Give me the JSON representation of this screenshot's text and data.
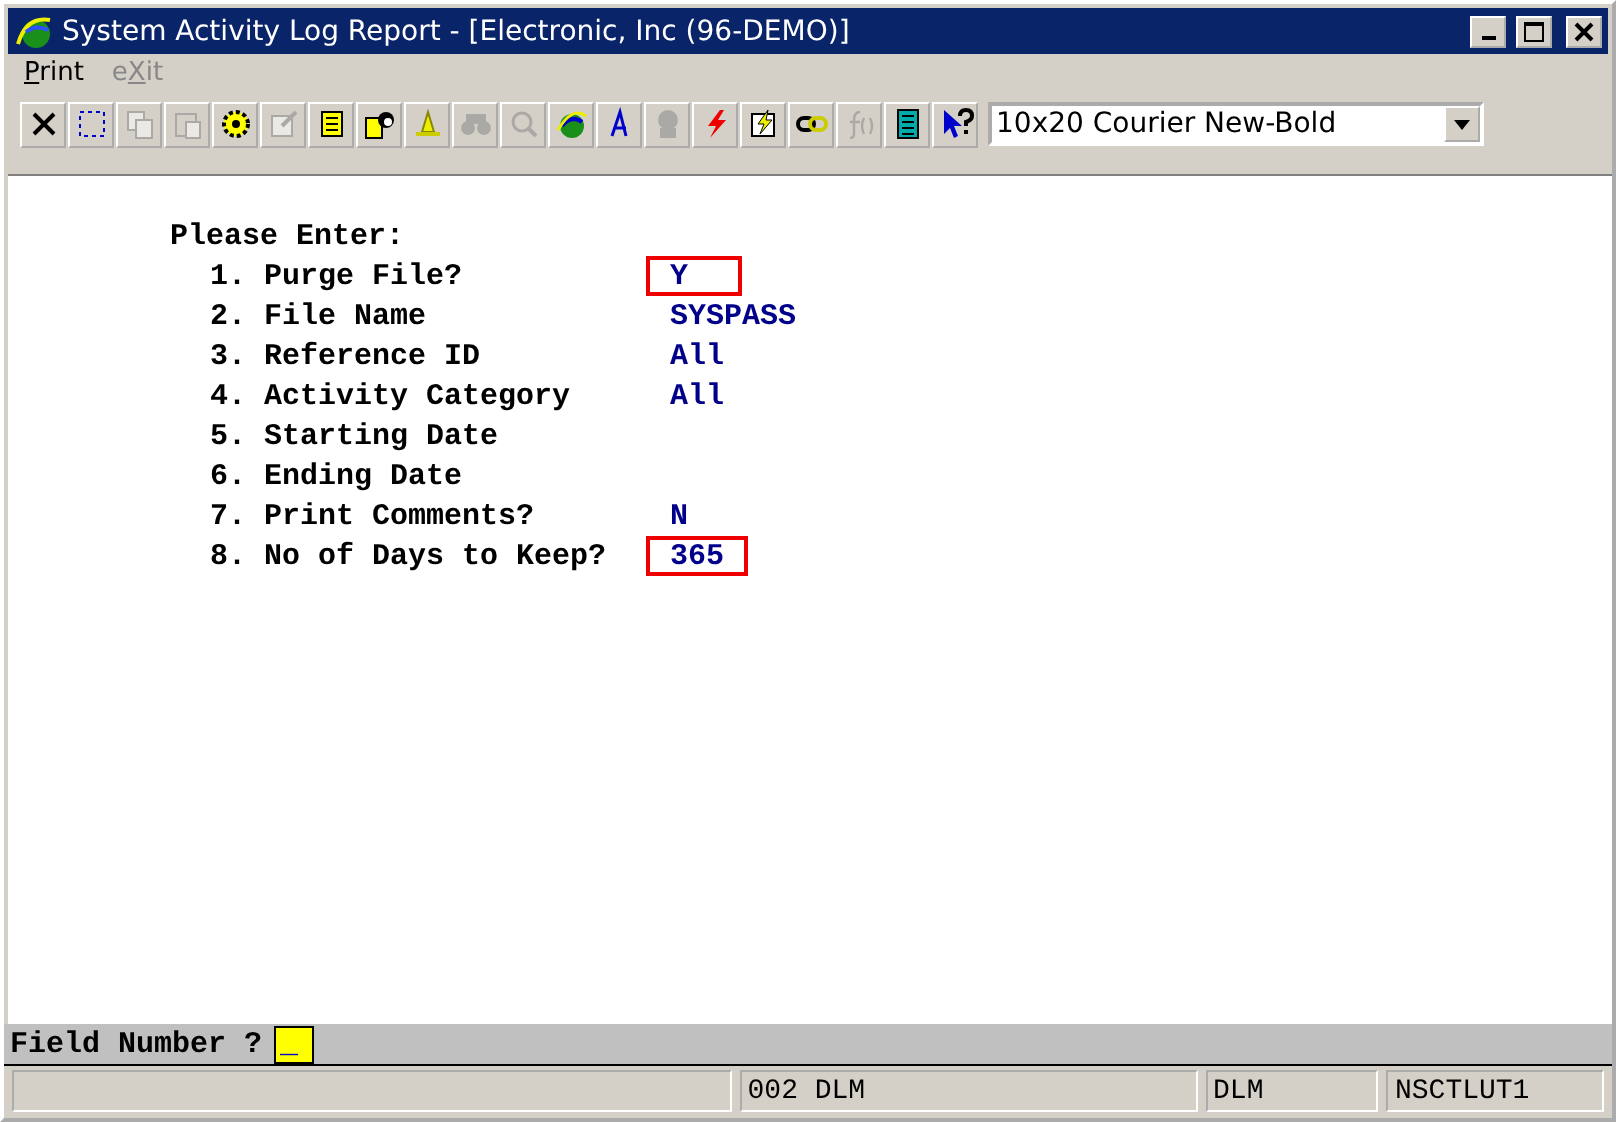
{
  "window": {
    "title": "System Activity Log Report - [Electronic, Inc (96-DEMO)]"
  },
  "menu": [
    {
      "key": "P",
      "after": "rint",
      "disabled": false
    },
    {
      "before": "e",
      "key": "X",
      "after": "it",
      "disabled": true
    }
  ],
  "toolbar": [
    {
      "kind": "close",
      "disabled": false
    },
    {
      "kind": "select",
      "disabled": false
    },
    {
      "kind": "copy",
      "disabled": true
    },
    {
      "kind": "paste",
      "disabled": true
    },
    {
      "kind": "gear",
      "disabled": false
    },
    {
      "kind": "properties",
      "disabled": true
    },
    {
      "kind": "note",
      "disabled": false
    },
    {
      "kind": "person",
      "disabled": false
    },
    {
      "kind": "bell",
      "disabled": false
    },
    {
      "kind": "binoculars",
      "disabled": true
    },
    {
      "kind": "magnifier",
      "disabled": true
    },
    {
      "kind": "globe",
      "disabled": false
    },
    {
      "kind": "font",
      "disabled": false
    },
    {
      "kind": "head",
      "disabled": true
    },
    {
      "kind": "bolt",
      "disabled": false
    },
    {
      "kind": "boltdoc",
      "disabled": false
    },
    {
      "kind": "link",
      "disabled": false
    },
    {
      "kind": "function",
      "disabled": true
    },
    {
      "kind": "calculator",
      "disabled": false
    },
    {
      "kind": "help",
      "disabled": false
    }
  ],
  "font_select": {
    "value": "10x20 Courier New-Bold"
  },
  "form": {
    "heading": "Please Enter:",
    "fields": [
      {
        "number": "1.",
        "label": "Purge File?",
        "value": "Y",
        "highlighted": true
      },
      {
        "number": "2.",
        "label": "File Name",
        "value": "SYSPASS",
        "highlighted": false
      },
      {
        "number": "3.",
        "label": "Reference ID",
        "value": "All",
        "highlighted": false
      },
      {
        "number": "4.",
        "label": "Activity Category",
        "value": "All",
        "highlighted": false
      },
      {
        "number": "5.",
        "label": "Starting Date",
        "highlighted": false
      },
      {
        "number": "6.",
        "label": "Ending Date",
        "highlighted": false
      },
      {
        "number": "7.",
        "label": "Print Comments?",
        "value": "N",
        "highlighted": false
      },
      {
        "number": "8.",
        "label": "No of Days to Keep?",
        "value": "365",
        "highlighted": true
      }
    ]
  },
  "prompt": {
    "label": "Field Number ?",
    "value": "_"
  },
  "status_bar": [
    "002 DLM",
    "DLM",
    "NSCTLUT1"
  ]
}
